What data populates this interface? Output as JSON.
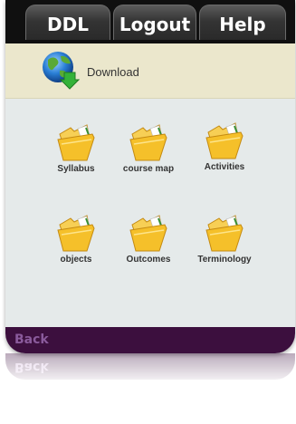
{
  "nav": {
    "ddl": "DDL",
    "logout": "Logout",
    "help": "Help"
  },
  "download": {
    "label": "Download",
    "icon": "globe-download-icon"
  },
  "folders": [
    {
      "label": "Syllabus",
      "icon": "folder-icon"
    },
    {
      "label": "course map",
      "icon": "folder-icon"
    },
    {
      "label": "Activities",
      "icon": "folder-icon"
    },
    {
      "label": "objects",
      "icon": "folder-icon"
    },
    {
      "label": "Outcomes",
      "icon": "folder-icon"
    },
    {
      "label": "Terminology",
      "icon": "folder-icon"
    }
  ],
  "footer": {
    "back": "Back"
  },
  "colors": {
    "topbar": "#101010",
    "download_bar": "#ebe7cc",
    "content_bg": "#e5eaea",
    "footer_bg": "#3c0f3e",
    "footer_text": "#8a5a9c",
    "folder_yellow": "#f5c02a"
  }
}
